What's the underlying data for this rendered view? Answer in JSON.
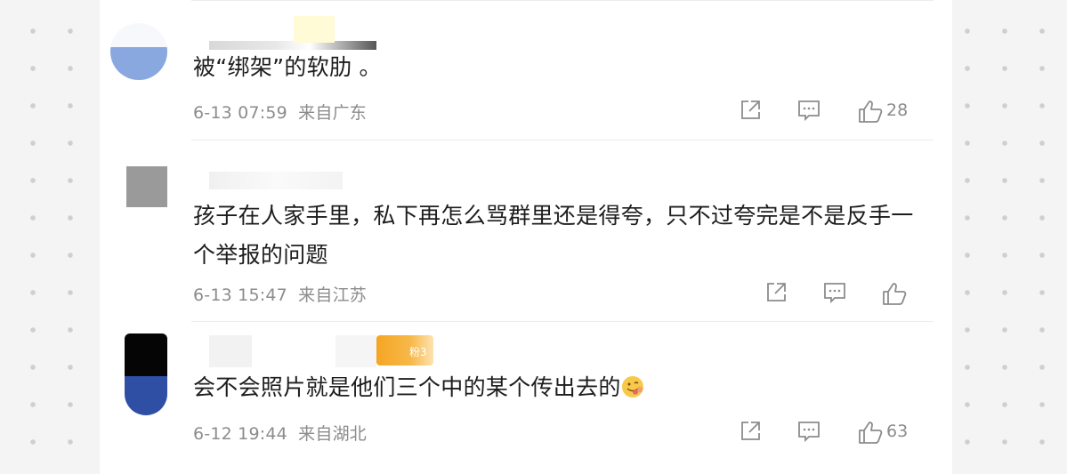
{
  "comments": [
    {
      "text": "被“绑架”的软肋 。",
      "date": "6-13 07:59",
      "location": "来自广东",
      "likes": "28"
    },
    {
      "text": "孩子在人家手里，私下再怎么骂群里还是得夸，只不过夸完是不是反手一个举报的问题",
      "date": "6-13 15:47",
      "location": "来自江苏",
      "likes": ""
    },
    {
      "text": "会不会照片就是他们三个中的某个传出去的",
      "emoji": "smiling-face-with-tongue-emoji",
      "badge": "粉3",
      "date": "6-12 19:44",
      "location": "来自湖北",
      "likes": "63"
    }
  ],
  "icons": {
    "share": "share-icon",
    "reply": "comment-icon",
    "like": "thumbs-up-icon"
  },
  "colors": {
    "badge": "#f5a623",
    "avatar1": "#8aa8e0",
    "avatar3": "#2f4fa5"
  }
}
